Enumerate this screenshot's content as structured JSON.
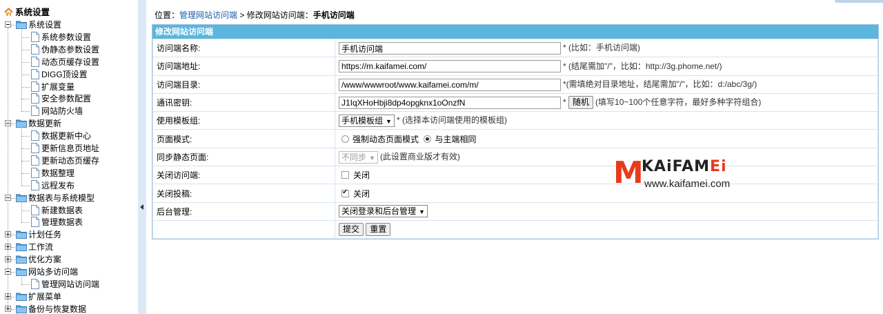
{
  "sidebar": {
    "root": "系统设置",
    "groups": [
      {
        "label": "系统设置",
        "state": "expanded",
        "children": [
          "系统参数设置",
          "伪静态参数设置",
          "动态页缓存设置",
          "DIGG顶设置",
          "扩展变量",
          "安全参数配置",
          "网站防火墙"
        ]
      },
      {
        "label": "数据更新",
        "state": "expanded",
        "children": [
          "数据更新中心",
          "更新信息页地址",
          "更新动态页缓存",
          "数据整理",
          "远程发布"
        ]
      },
      {
        "label": "数据表与系统模型",
        "state": "expanded",
        "children": [
          "新建数据表",
          "管理数据表"
        ]
      },
      {
        "label": "计划任务",
        "state": "collapsed",
        "children": []
      },
      {
        "label": "工作流",
        "state": "collapsed",
        "children": []
      },
      {
        "label": "优化方案",
        "state": "collapsed",
        "children": []
      },
      {
        "label": "网站多访问端",
        "state": "expanded",
        "children": [
          "管理网站访问端"
        ]
      },
      {
        "label": "扩展菜单",
        "state": "collapsed",
        "children": []
      },
      {
        "label": "备份与恢复数据",
        "state": "collapsed",
        "children": []
      }
    ]
  },
  "breadcrumb": {
    "prefix": "位置：",
    "link": "管理网站访问端",
    "sep": " > ",
    "middle": "修改网站访问端：",
    "current": "手机访问端"
  },
  "form": {
    "title": "修改网站访问端",
    "name": {
      "label": "访问端名称:",
      "value": "手机访问端",
      "hint": "* (比如：手机访问端)"
    },
    "url": {
      "label": "访问端地址:",
      "value": "https://m.kaifamei.com/",
      "hint": "* (结尾需加\"/\"，比如：http://3g.phome.net/)"
    },
    "dir": {
      "label": "访问端目录:",
      "value": "/www/wwwroot/www.kaifamei.com/m/",
      "hint": "*(需填绝对目录地址，结尾需加\"/\"，比如：d:/abc/3g/)"
    },
    "key": {
      "label": "通讯密钥:",
      "value": "J1IqXHoHbji8dp4opgknx1oOnzfN",
      "star": "*",
      "button": "随机",
      "hint": "(填写10~100个任意字符，最好多种字符组合)"
    },
    "template": {
      "label": "使用模板组:",
      "value": "手机模板组",
      "hint": "* (选择本访问端使用的模板组)"
    },
    "mode": {
      "label": "页面模式:",
      "options": [
        {
          "text": "强制动态页面模式",
          "checked": false
        },
        {
          "text": "与主端相同",
          "checked": true
        }
      ]
    },
    "sync": {
      "label": "同步静态页面:",
      "value": "不同步",
      "hint": "(此设置商业版才有效)"
    },
    "close_access": {
      "label": "关闭访问端:",
      "text": "关闭",
      "checked": false
    },
    "close_submit": {
      "label": "关闭投稿:",
      "text": "关闭",
      "checked": true
    },
    "admin": {
      "label": "后台管理:",
      "value": "关闭登录和后台管理"
    },
    "submit_label": "提交",
    "reset_label": "重置"
  },
  "watermark": {
    "logo_m": "M",
    "logo_word_a": "KAiFAM",
    "logo_word_b": "Ei",
    "url": "www.kaifamei.com"
  },
  "colors": {
    "panel_header": "#5bb5dc",
    "splitter": "#dce9f5",
    "link": "#1a5fa8",
    "logo_red": "#e83a1c"
  }
}
